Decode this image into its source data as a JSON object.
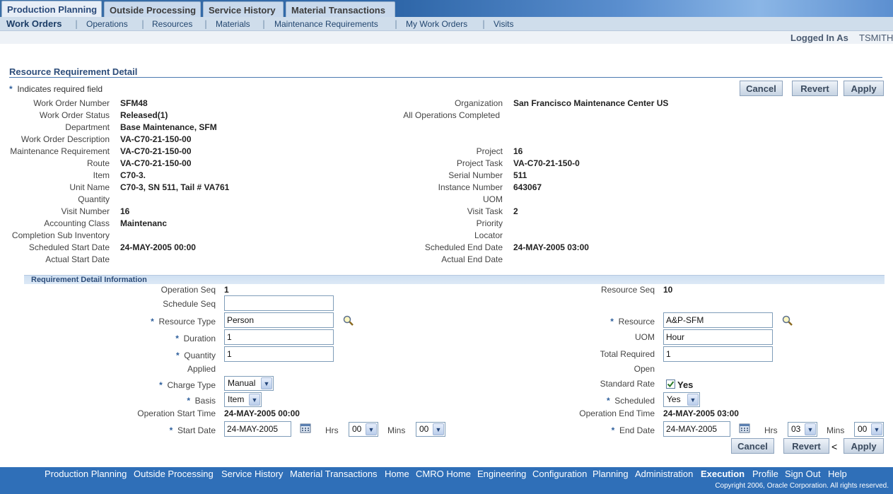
{
  "tabs": [
    "Production Planning",
    "Outside Processing",
    "Service History",
    "Material Transactions"
  ],
  "subnav": [
    "Work Orders",
    "Operations",
    "Resources",
    "Materials",
    "Maintenance Requirements",
    "My Work Orders",
    "Visits"
  ],
  "login": {
    "label": "Logged In As",
    "user": "TSMITH"
  },
  "page_title": "Resource Requirement Detail",
  "required_note": "Indicates required field",
  "buttons": {
    "cancel": "Cancel",
    "revert": "Revert",
    "apply": "Apply"
  },
  "star": "*",
  "left_fields": [
    {
      "label": "Work Order Number",
      "value": "SFM48"
    },
    {
      "label": "Work Order Status",
      "value": "Released(1)"
    },
    {
      "label": "Department",
      "value": "Base Maintenance, SFM"
    },
    {
      "label": "Work Order Description",
      "value": "VA-C70-21-150-00"
    },
    {
      "label": "Maintenance Requirement",
      "value": "VA-C70-21-150-00"
    },
    {
      "label": "Route",
      "value": "VA-C70-21-150-00"
    },
    {
      "label": "Item",
      "value": "C70-3."
    },
    {
      "label": "Unit Name",
      "value": "C70-3, SN 511, Tail # VA761"
    },
    {
      "label": "Quantity",
      "value": ""
    },
    {
      "label": "Visit Number",
      "value": "16"
    },
    {
      "label": "Accounting Class",
      "value": "Maintenanc"
    },
    {
      "label": "Completion Sub Inventory",
      "value": ""
    },
    {
      "label": "Scheduled Start Date",
      "value": "24-MAY-2005 00:00"
    },
    {
      "label": "Actual Start Date",
      "value": ""
    }
  ],
  "right_fields": [
    {
      "label": "Organization",
      "value": "San Francisco Maintenance Center US"
    },
    {
      "label": "All Operations Completed",
      "value": ""
    },
    {
      "label": "",
      "value": ""
    },
    {
      "label": "",
      "value": ""
    },
    {
      "label": "Project",
      "value": "16"
    },
    {
      "label": "Project Task",
      "value": "VA-C70-21-150-0"
    },
    {
      "label": "Serial Number",
      "value": "511"
    },
    {
      "label": "Instance Number",
      "value": "643067"
    },
    {
      "label": "UOM",
      "value": ""
    },
    {
      "label": "Visit Task",
      "value": "2"
    },
    {
      "label": "Priority",
      "value": ""
    },
    {
      "label": "Locator",
      "value": ""
    },
    {
      "label": "Scheduled End Date",
      "value": "24-MAY-2005 03:00"
    },
    {
      "label": "Actual End Date",
      "value": ""
    }
  ],
  "section_title": "Requirement Detail Information",
  "req": {
    "operation_seq": {
      "label": "Operation Seq",
      "value": "1"
    },
    "schedule_seq": {
      "label": "Schedule Seq",
      "value": ""
    },
    "resource_type": {
      "label": "Resource Type",
      "value": "Person"
    },
    "duration": {
      "label": "Duration",
      "value": "1"
    },
    "quantity": {
      "label": "Quantity",
      "value": "1"
    },
    "applied": {
      "label": "Applied",
      "value": ""
    },
    "charge_type": {
      "label": "Charge Type",
      "value": "Manual"
    },
    "basis": {
      "label": "Basis",
      "value": "Item"
    },
    "op_start": {
      "label": "Operation Start Time",
      "value": "24-MAY-2005 00:00"
    },
    "start_date": {
      "label": "Start Date",
      "value": "24-MAY-2005",
      "hrs_label": "Hrs",
      "hrs": "00",
      "mins_label": "Mins",
      "mins": "00"
    },
    "resource_seq": {
      "label": "Resource Seq",
      "value": "10"
    },
    "resource": {
      "label": "Resource",
      "value": "A&P-SFM"
    },
    "uom": {
      "label": "UOM",
      "value": "Hour"
    },
    "total_required": {
      "label": "Total Required",
      "value": "1"
    },
    "open": {
      "label": "Open",
      "value": ""
    },
    "standard_rate": {
      "label": "Standard Rate",
      "value": "Yes"
    },
    "scheduled": {
      "label": "Scheduled",
      "value": "Yes"
    },
    "op_end": {
      "label": "Operation End Time",
      "value": "24-MAY-2005 03:00"
    },
    "end_date": {
      "label": "End Date",
      "value": "24-MAY-2005",
      "hrs_label": "Hrs",
      "hrs": "03",
      "mins_label": "Mins",
      "mins": "00"
    }
  },
  "stray_char": "<",
  "footer_links": [
    "Production Planning",
    "Outside Processing",
    "Service History",
    "Material Transactions",
    "Home",
    "CMRO Home",
    "Engineering",
    "Configuration",
    "Planning",
    "Administration",
    "Execution",
    "Profile",
    "Sign Out",
    "Help"
  ],
  "copyright": "Copyright 2006, Oracle Corporation. All rights reserved.",
  "colors": {
    "brand_blue": "#2f6fb8",
    "tab_bg": "#c9d9ec",
    "required_star": "#2e5f9c"
  }
}
